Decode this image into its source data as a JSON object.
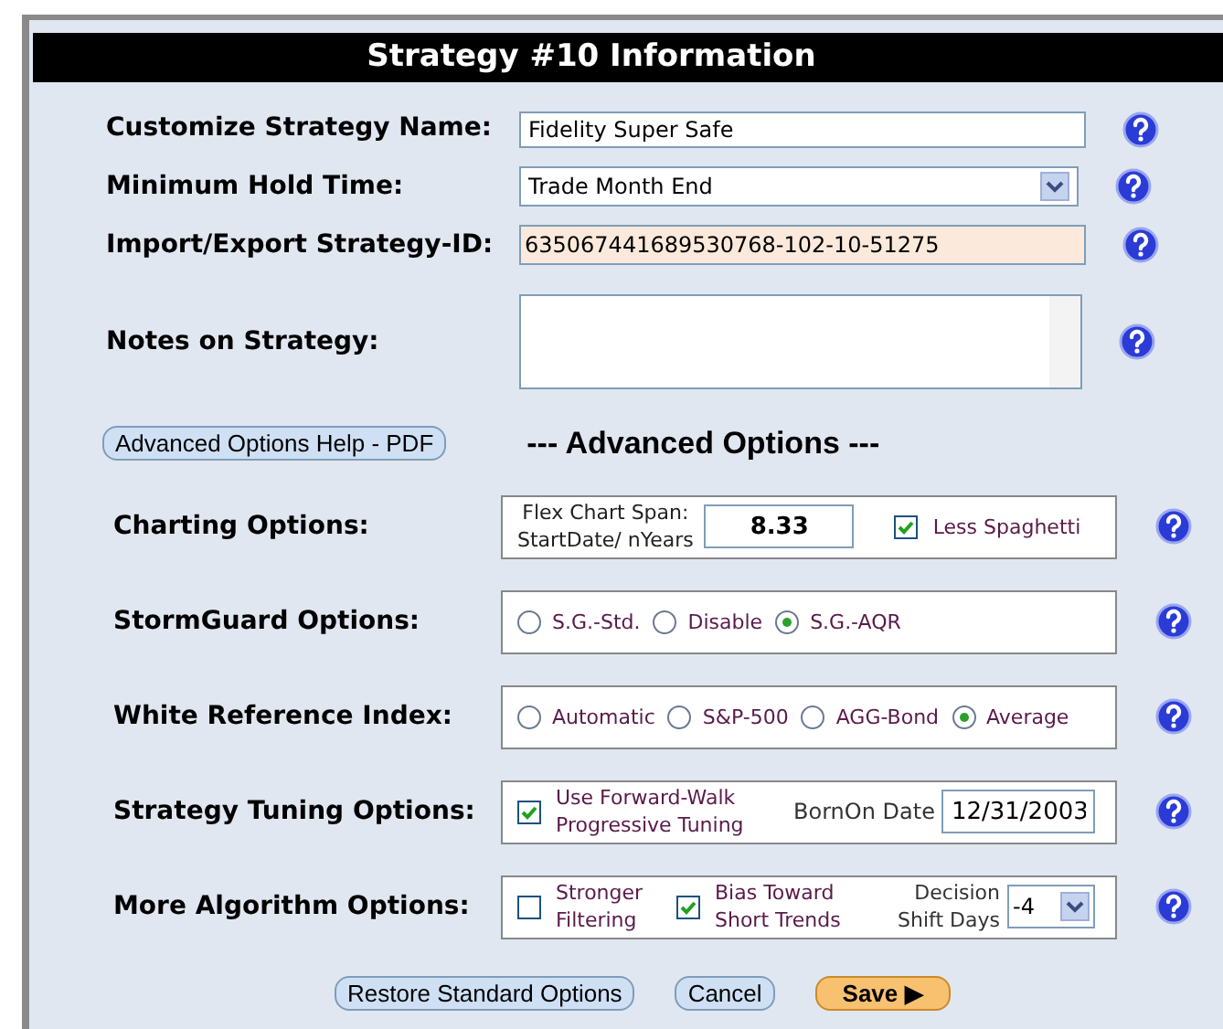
{
  "title": "Strategy #10  Information",
  "fields": [
    {
      "kind": "text",
      "label": "Customize Strategy Name:",
      "value": "Fidelity Super Safe"
    },
    {
      "kind": "select",
      "label": "Minimum Hold Time:",
      "value": "Trade Month End"
    },
    {
      "kind": "id",
      "label": "Import/Export Strategy-ID:",
      "value": "635067441689530768-102-10-51275"
    },
    {
      "kind": "textarea",
      "label": "Notes on Strategy:"
    }
  ],
  "help_pdf_button": "Advanced Options Help - PDF",
  "advanced_heading": "---  Advanced Options  ---",
  "options": [
    {
      "kind": "span",
      "label": "Charting Options:",
      "span_label": "Flex Chart Span:",
      "span_sublabel": "StartDate/ nYears",
      "span_value": "8.33",
      "checkbox": {
        "label": "Less Spaghetti",
        "checked": true
      }
    },
    {
      "kind": "radios",
      "label": "StormGuard Options:",
      "radios": [
        {
          "label": "S.G.-Std.",
          "selected": false
        },
        {
          "label": "Disable",
          "selected": false
        },
        {
          "label": "S.G.-AQR",
          "selected": true
        }
      ]
    },
    {
      "kind": "radios",
      "label": "White Reference Index:",
      "radios": [
        {
          "label": "Automatic",
          "selected": false
        },
        {
          "label": "S&P-500",
          "selected": false
        },
        {
          "label": "AGG-Bond",
          "selected": false
        },
        {
          "label": "Average",
          "selected": true
        }
      ]
    },
    {
      "kind": "tuning",
      "label": "Strategy Tuning Options:",
      "checkbox": {
        "label": "Use Forward-Walk Progressive Tuning",
        "checked": true
      },
      "date_label": "BornOn Date",
      "date_value": "12/31/2003"
    },
    {
      "kind": "algorithm",
      "label": "More Algorithm Options:",
      "checkboxes": [
        {
          "label": "Stronger Filtering",
          "checked": false
        },
        {
          "label": "Bias Toward Short Trends",
          "checked": true
        }
      ],
      "shift_label": "Decision Shift Days",
      "shift_value": "-4"
    }
  ],
  "buttons": [
    {
      "kind": "plain",
      "label": "Restore Standard Options"
    },
    {
      "kind": "plain",
      "label": "Cancel"
    },
    {
      "kind": "primary",
      "label": "Save ▶"
    }
  ]
}
